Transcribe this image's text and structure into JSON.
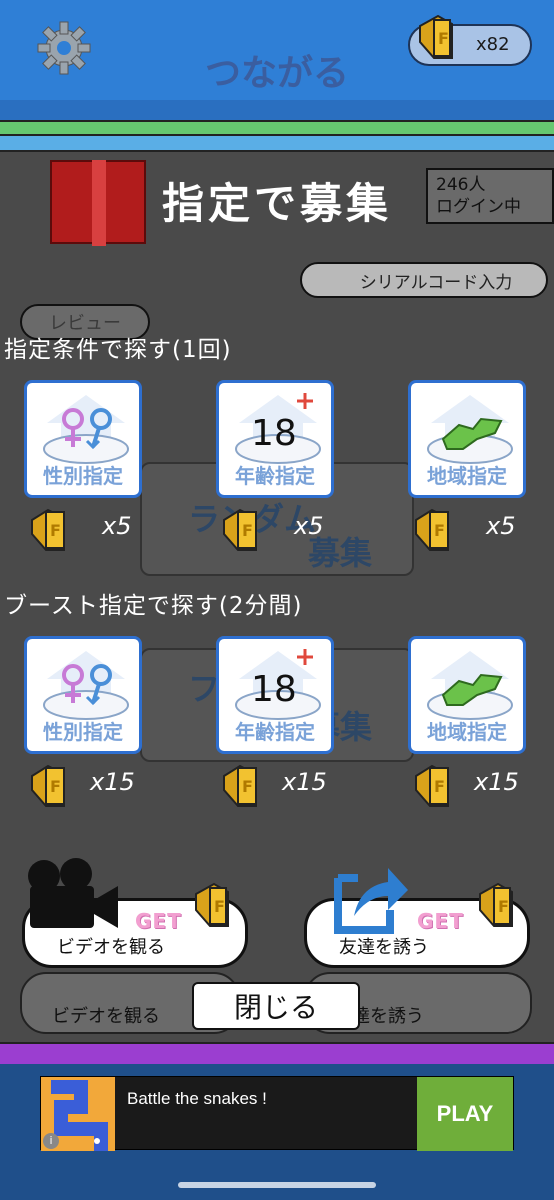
{
  "header": {
    "title": "つながる",
    "coin_count": "x82"
  },
  "background": {
    "login_count": "246人",
    "login_label": "ログイン中",
    "serial_code_label": "シリアルコード入力",
    "review_label": "レビュー",
    "ghost_random_1": "ランダム",
    "ghost_recruit_1": "募集",
    "ghost_random_2": "フ  で",
    "ghost_recruit_2": "募集",
    "ghost_video_label": "ビデオを観る",
    "ghost_invite_label": "達を誘う",
    "ghost_get": "GET"
  },
  "modal": {
    "title": "指定で募集",
    "section_normal": "指定条件で探す(1回)",
    "section_boost": "ブースト指定で探す(2分間)",
    "normal_options": [
      {
        "label": "性別指定",
        "cost": "x5"
      },
      {
        "label": "年齢指定",
        "cost": "x5"
      },
      {
        "label": "地域指定",
        "cost": "x5"
      }
    ],
    "boost_options": [
      {
        "label": "性別指定",
        "cost": "x15"
      },
      {
        "label": "年齢指定",
        "cost": "x15"
      },
      {
        "label": "地域指定",
        "cost": "x15"
      }
    ],
    "age_icon_text": "18",
    "video_button": {
      "get": "GET",
      "label": "ビデオを観る"
    },
    "invite_button": {
      "get": "GET",
      "label": "友達を誘う"
    },
    "close_label": "閉じる"
  },
  "ad": {
    "text": "Battle the snakes !",
    "cta": "PLAY",
    "info": "i"
  },
  "colors": {
    "card_border": "#2e6fd0",
    "card_label": "#7aa2d8",
    "ticket": "#f2c230",
    "get_pink": "#f29fd0",
    "play_green": "#6fae3a",
    "stripe_green": "#66c770",
    "stripe_purple": "#9b3ed0"
  }
}
